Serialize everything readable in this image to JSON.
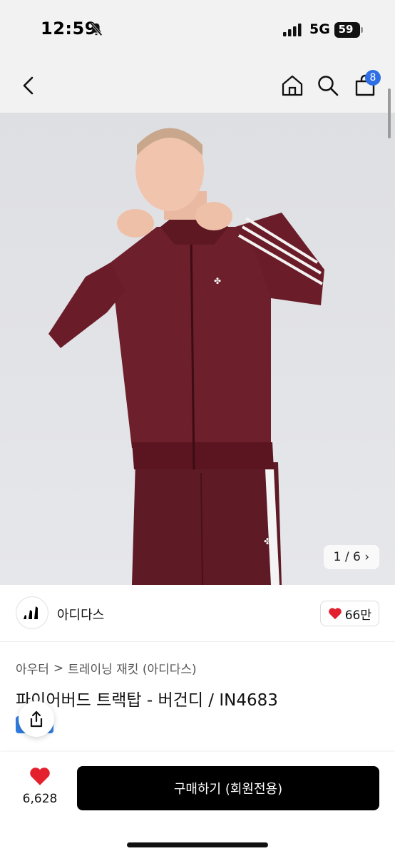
{
  "status": {
    "time": "12:59",
    "network": "5G",
    "battery": "59"
  },
  "header": {
    "cart_count": "8"
  },
  "gallery": {
    "counter": "1 / 6"
  },
  "brand": {
    "name": "아디다스",
    "likes": "66만"
  },
  "breadcrumb": {
    "category": "아우터",
    "separator": ">",
    "subcategory": "트레이닝 재킷 (아디다스)"
  },
  "product": {
    "title": "파이어버드 트랙탑 - 버건디 / IN4683"
  },
  "bottom": {
    "wish_count": "6,628",
    "buy_label": "구매하기 (회원전용)"
  },
  "colors": {
    "accent_badge": "#2f6fe4",
    "heart": "#e5202e",
    "buy_button": "#000000",
    "jacket": "#6d1f2b"
  },
  "icons": [
    "bell-off-icon",
    "back-icon",
    "home-icon",
    "search-icon",
    "cart-icon",
    "heart-icon",
    "share-icon",
    "adidas-logo-icon"
  ]
}
